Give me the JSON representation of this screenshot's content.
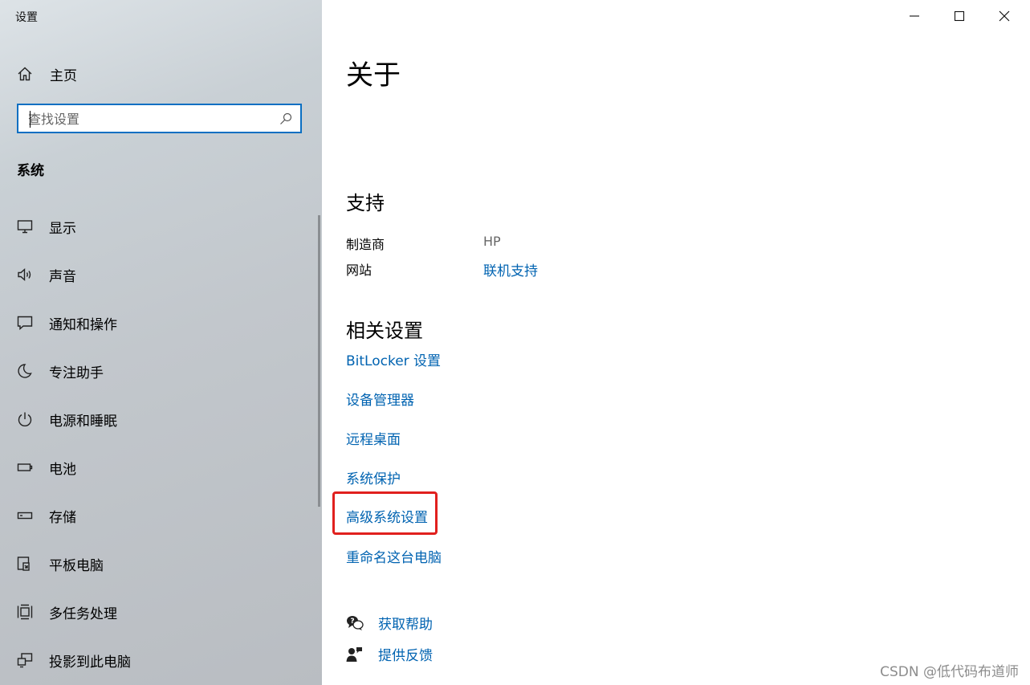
{
  "window": {
    "title": "设置"
  },
  "sidebar": {
    "home_label": "主页",
    "search_placeholder": "查找设置",
    "section_title": "系统",
    "items": [
      {
        "label": "显示",
        "icon": "monitor-icon"
      },
      {
        "label": "声音",
        "icon": "speaker-icon"
      },
      {
        "label": "通知和操作",
        "icon": "notification-icon"
      },
      {
        "label": "专注助手",
        "icon": "moon-icon"
      },
      {
        "label": "电源和睡眠",
        "icon": "power-icon"
      },
      {
        "label": "电池",
        "icon": "battery-icon"
      },
      {
        "label": "存储",
        "icon": "storage-icon"
      },
      {
        "label": "平板电脑",
        "icon": "tablet-icon"
      },
      {
        "label": "多任务处理",
        "icon": "multitasking-icon"
      },
      {
        "label": "投影到此电脑",
        "icon": "projection-icon"
      }
    ]
  },
  "main": {
    "title": "关于",
    "support": {
      "heading": "支持",
      "manufacturer_label": "制造商",
      "manufacturer_value": "HP",
      "website_label": "网站",
      "website_value": "联机支持"
    },
    "related": {
      "heading": "相关设置",
      "links": [
        "BitLocker 设置",
        "设备管理器",
        "远程桌面",
        "系统保护",
        "高级系统设置",
        "重命名这台电脑"
      ]
    },
    "help": {
      "get_help": "获取帮助",
      "feedback": "提供反馈"
    },
    "watermark": "CSDN @低代码布道师"
  },
  "colors": {
    "accent": "#0063b1",
    "search_border": "#0a6fc2",
    "highlight": "#e0201e"
  }
}
